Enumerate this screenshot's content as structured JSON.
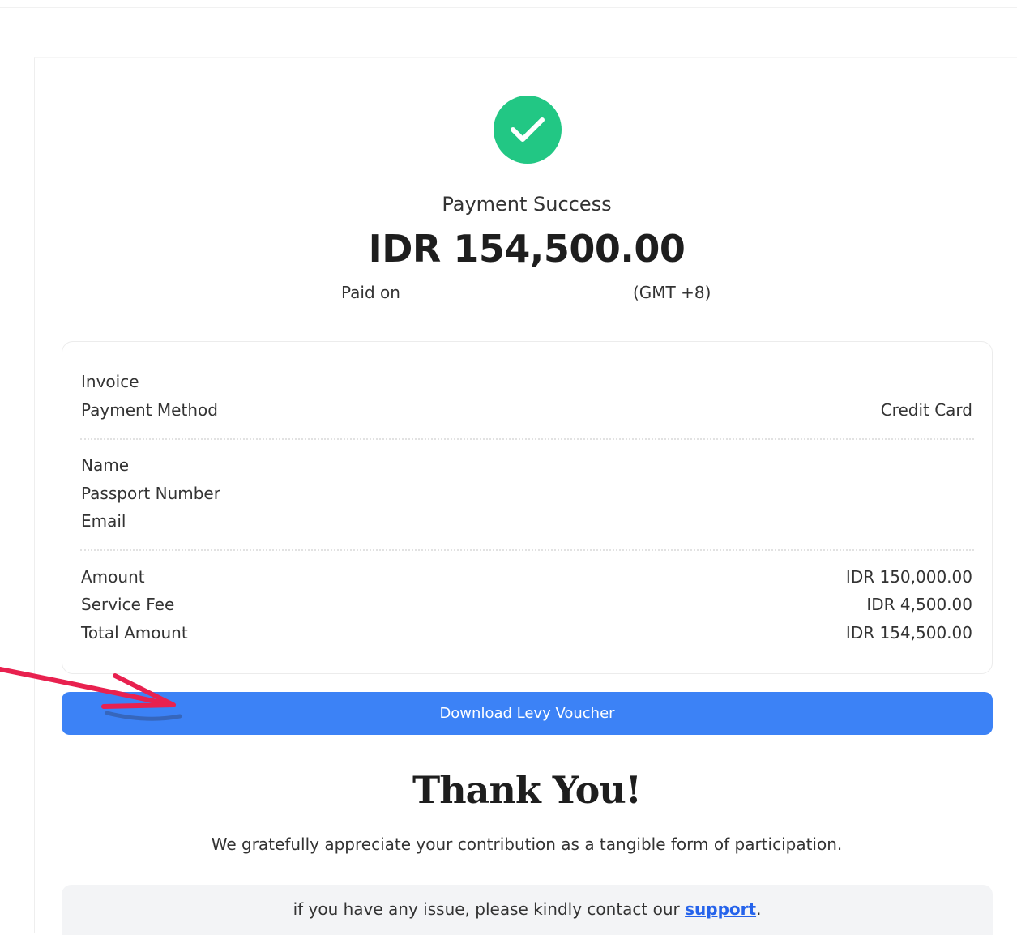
{
  "header": {
    "icon": "check-circle-icon",
    "status": "Payment Success",
    "amount": "IDR 154,500.00",
    "paid_on_label": "Paid on",
    "timezone": "(GMT +8)"
  },
  "details": {
    "invoice_label": "Invoice",
    "payment_method_label": "Payment Method",
    "payment_method_value": "Credit Card",
    "name_label": "Name",
    "passport_label": "Passport Number",
    "email_label": "Email",
    "amount_label": "Amount",
    "amount_value": "IDR 150,000.00",
    "service_fee_label": "Service Fee",
    "service_fee_value": "IDR 4,500.00",
    "total_label": "Total Amount",
    "total_value": "IDR 154,500.00"
  },
  "actions": {
    "download_label": "Download Levy Voucher"
  },
  "thanks": {
    "title": "Thank You!",
    "message": "We gratefully appreciate your contribution as a tangible form of participation."
  },
  "support": {
    "prefix": "if you have any issue, please kindly contact our ",
    "link": "support",
    "suffix": "."
  },
  "colors": {
    "success": "#22c784",
    "primary": "#3c82f6",
    "annotation": "#e8214f",
    "link": "#2563eb"
  }
}
